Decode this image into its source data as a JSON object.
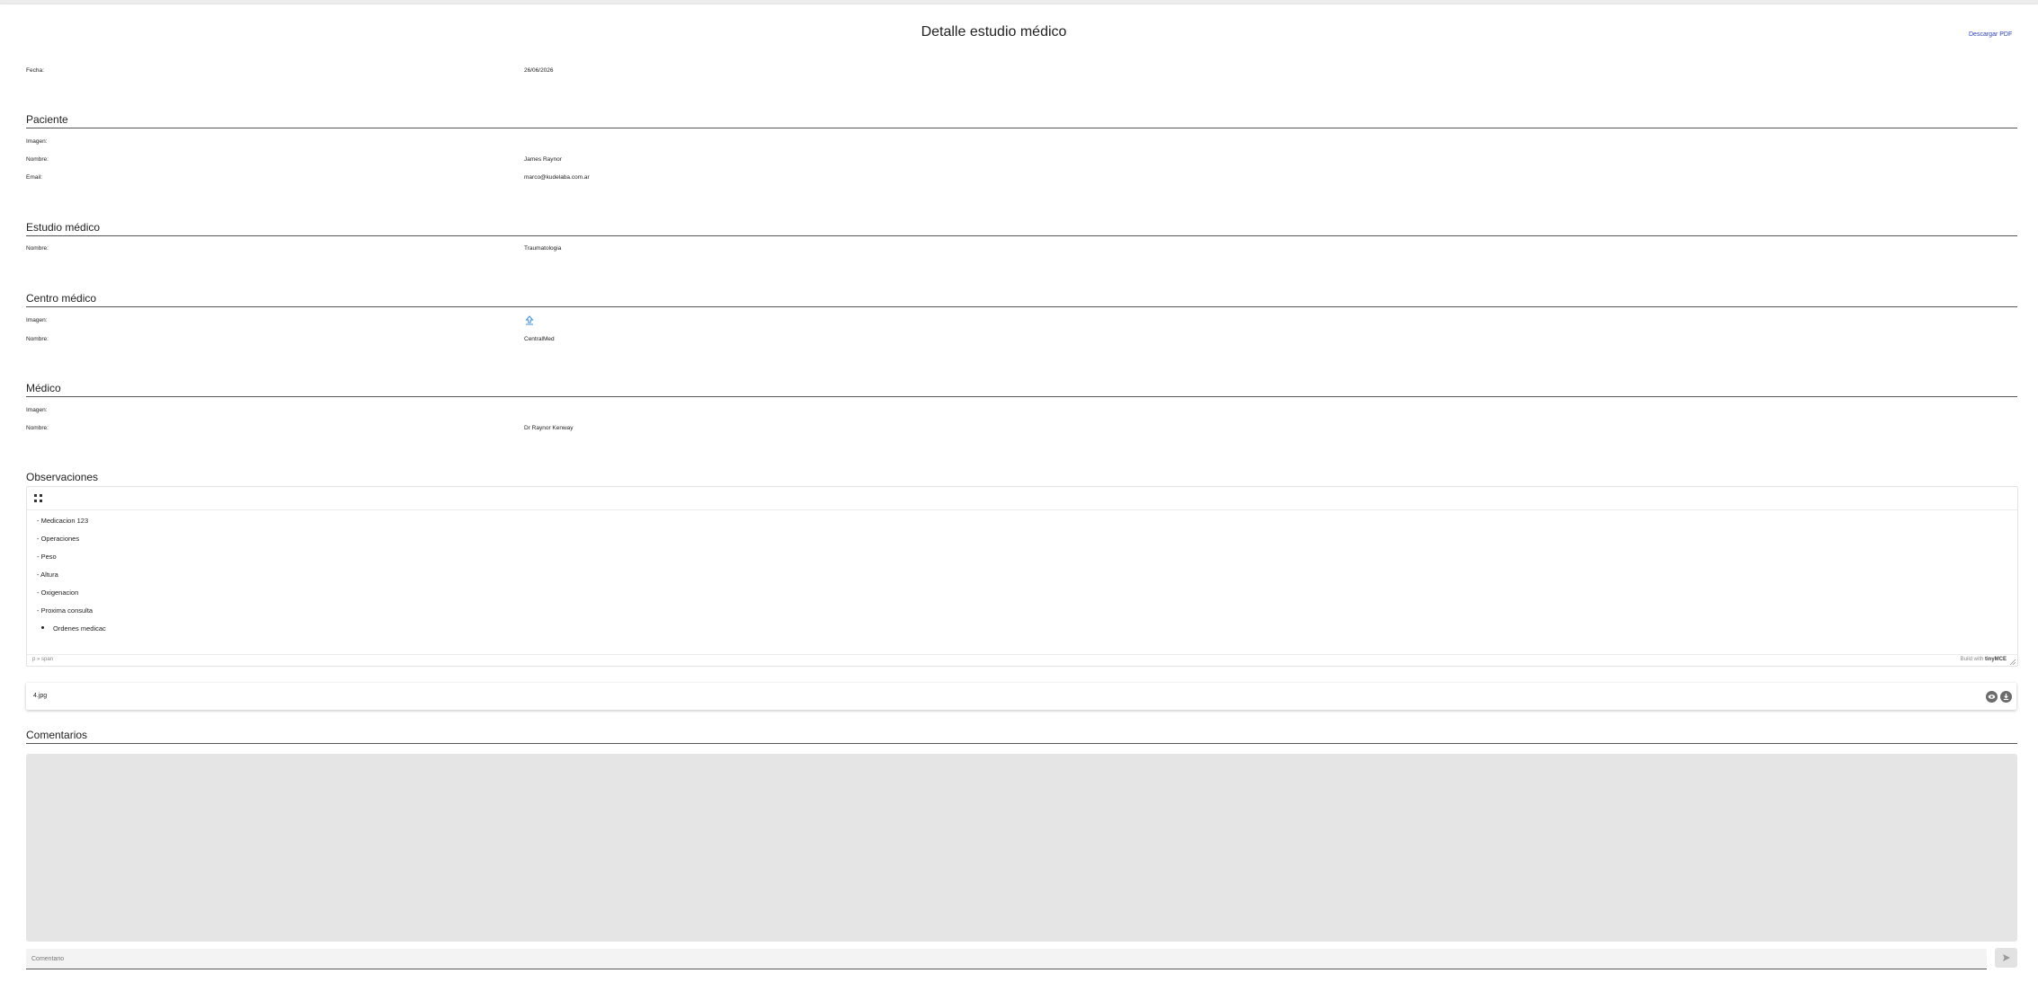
{
  "header": {
    "title": "Detalle estudio médico",
    "pdf_link": "Descargar PDF"
  },
  "fecha": {
    "label": "Fecha:",
    "value": "26/06/2026"
  },
  "paciente": {
    "heading": "Paciente",
    "imagen_label": "Imagen:",
    "nombre_label": "Nombre:",
    "nombre": "James Raynor",
    "email_label": "Email:",
    "email": "marco@kudelaba.com.ar"
  },
  "estudio": {
    "heading": "Estudio médico",
    "nombre_label": "Nombre:",
    "nombre": "Traumatologia"
  },
  "centro": {
    "heading": "Centro médico",
    "imagen_label": "Imagen:",
    "imagen_icon": "upload-icon",
    "nombre_label": "Nombre:",
    "nombre": "CentralMed"
  },
  "medico": {
    "heading": "Médico",
    "imagen_label": "Imagen:",
    "nombre_label": "Nombre:",
    "nombre": "Dr Raynor Kenway"
  },
  "observaciones": {
    "heading": "Observaciones",
    "lines": [
      "- Medicacion 123",
      "- Operaciones",
      "- Peso",
      "- Altura",
      "- Oxigenacion",
      "- Proxima consulta"
    ],
    "bullet_item": "Ordenes medicac",
    "status_path": "p » span",
    "brand_prefix": "Build with",
    "brand_name": "tinyMCE"
  },
  "attachment": {
    "file_name": "4.jpg"
  },
  "comentarios": {
    "heading": "Comentarios",
    "input_placeholder": "Comentario"
  },
  "colors": {
    "accent": "#2a3fb5",
    "icon_blue": "#3a8fd8",
    "comments_bg": "#e5e5e5"
  }
}
